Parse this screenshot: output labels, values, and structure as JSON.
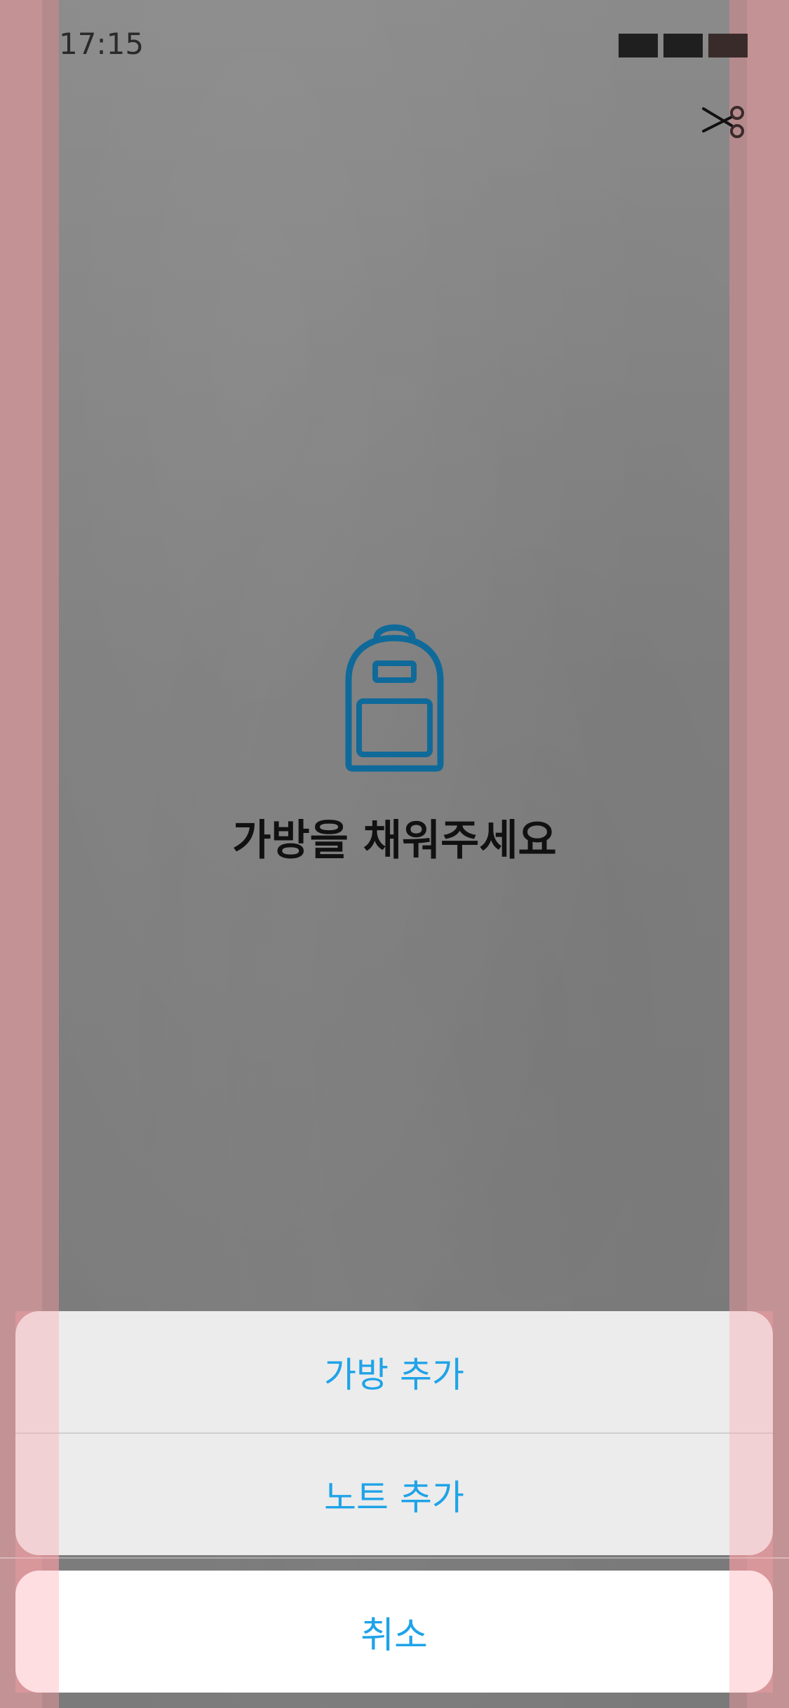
{
  "status_bar": {
    "time": "17:15"
  },
  "toolbar": {
    "scissors_icon": "scissors-icon"
  },
  "empty_state": {
    "icon": "backpack-icon",
    "title": "가방을 채워주세요",
    "icon_color": "#0f6a9a"
  },
  "action_sheet": {
    "items": [
      {
        "label": "가방 추가"
      },
      {
        "label": "노트 추가"
      }
    ],
    "cancel_label": "취소",
    "accent_color": "#1fa3e8"
  }
}
